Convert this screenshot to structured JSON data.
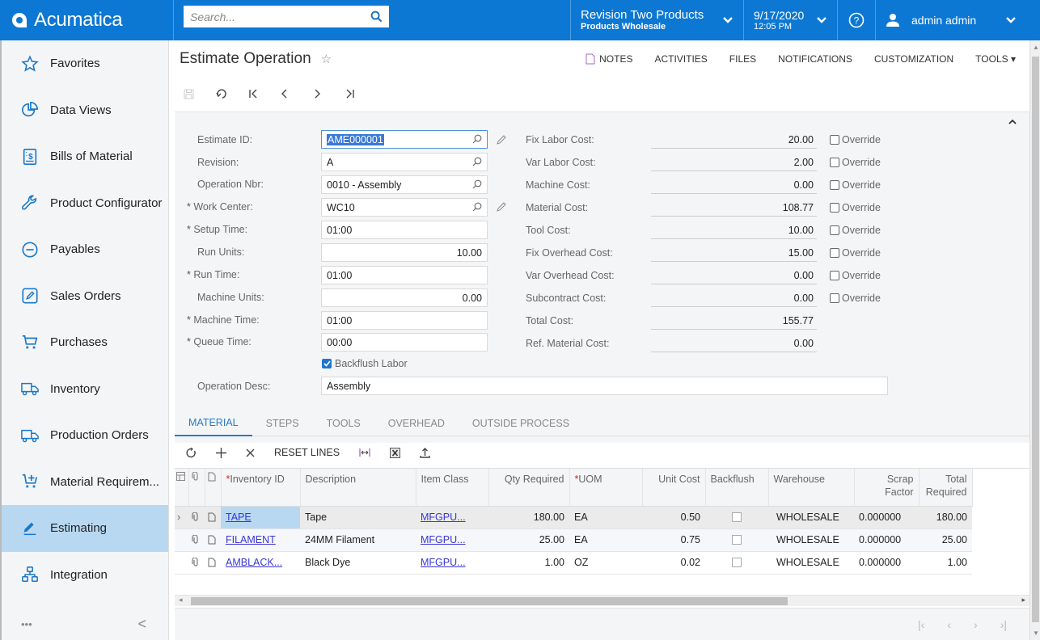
{
  "app": {
    "brand": "Acumatica",
    "search_placeholder": "Search...",
    "company": {
      "name": "Revision Two Products",
      "branch": "Products Wholesale"
    },
    "date": "9/17/2020",
    "time": "12:05 PM",
    "user": "admin admin",
    "accent_color": "#0c78d4"
  },
  "sidebar": {
    "items": [
      {
        "label": "Favorites",
        "icon": "star-icon"
      },
      {
        "label": "Data Views",
        "icon": "pie-chart-icon"
      },
      {
        "label": "Bills of Material",
        "icon": "bill-icon"
      },
      {
        "label": "Product Configurator",
        "icon": "wrench-icon"
      },
      {
        "label": "Payables",
        "icon": "minus-circle-icon"
      },
      {
        "label": "Sales Orders",
        "icon": "edit-square-icon"
      },
      {
        "label": "Purchases",
        "icon": "cart-icon"
      },
      {
        "label": "Inventory",
        "icon": "truck-icon"
      },
      {
        "label": "Production Orders",
        "icon": "truck-icon"
      },
      {
        "label": "Material Requirem...",
        "icon": "cart-plus-icon"
      },
      {
        "label": "Estimating",
        "icon": "pencil-icon",
        "active": true
      },
      {
        "label": "Integration",
        "icon": "hierarchy-icon"
      }
    ],
    "more": "•••",
    "collapse": "<"
  },
  "page": {
    "title": "Estimate Operation",
    "actions": [
      "NOTES",
      "ACTIVITIES",
      "FILES",
      "NOTIFICATIONS",
      "CUSTOMIZATION",
      "TOOLS"
    ]
  },
  "form": {
    "left": {
      "estimate_id": {
        "label": "Estimate ID:",
        "value": "AME000001"
      },
      "revision": {
        "label": "Revision:",
        "value": "A"
      },
      "operation_nbr": {
        "label": "Operation Nbr:",
        "value": "0010 - Assembly"
      },
      "work_center": {
        "label": "Work Center:",
        "value": "WC10"
      },
      "setup_time": {
        "label": "Setup Time:",
        "value": "01:00"
      },
      "run_units": {
        "label": "Run Units:",
        "value": "10.00"
      },
      "run_time": {
        "label": "Run Time:",
        "value": "01:00"
      },
      "machine_units": {
        "label": "Machine Units:",
        "value": "0.00"
      },
      "machine_time": {
        "label": "Machine Time:",
        "value": "01:00"
      },
      "queue_time": {
        "label": "Queue Time:",
        "value": "00:00"
      },
      "backflush_labor": {
        "label": "Backflush Labor",
        "checked": true
      },
      "operation_desc": {
        "label": "Operation Desc:",
        "value": "Assembly"
      }
    },
    "costs": [
      {
        "label": "Fix Labor Cost:",
        "value": "20.00",
        "override": "Override"
      },
      {
        "label": "Var Labor Cost:",
        "value": "2.00",
        "override": "Override"
      },
      {
        "label": "Machine Cost:",
        "value": "0.00",
        "override": "Override"
      },
      {
        "label": "Material Cost:",
        "value": "108.77",
        "override": "Override"
      },
      {
        "label": "Tool Cost:",
        "value": "10.00",
        "override": "Override"
      },
      {
        "label": "Fix Overhead Cost:",
        "value": "15.00",
        "override": "Override"
      },
      {
        "label": "Var Overhead Cost:",
        "value": "0.00",
        "override": "Override"
      },
      {
        "label": "Subcontract Cost:",
        "value": "0.00",
        "override": "Override"
      },
      {
        "label": "Total Cost:",
        "value": "155.77"
      },
      {
        "label": "Ref. Material Cost:",
        "value": "0.00"
      }
    ]
  },
  "tabs": [
    "MATERIAL",
    "STEPS",
    "TOOLS",
    "OVERHEAD",
    "OUTSIDE PROCESS"
  ],
  "grid_toolbar": {
    "reset_lines": "RESET LINES"
  },
  "grid": {
    "headers": {
      "inventory_id": "Inventory ID",
      "description": "Description",
      "item_class": "Item Class",
      "qty_required": "Qty Required",
      "uom": "UOM",
      "unit_cost": "Unit Cost",
      "backflush": "Backflush",
      "warehouse": "Warehouse",
      "scrap_factor": "Scrap Factor",
      "total_required": "Total Required"
    },
    "rows": [
      {
        "inventory_id": "TAPE",
        "description": "Tape",
        "item_class": "MFGPU...",
        "qty_required": "180.00",
        "uom": "EA",
        "unit_cost": "0.50",
        "backflush": false,
        "warehouse": "WHOLESALE",
        "scrap_factor": "0.000000",
        "total_required": "180.00"
      },
      {
        "inventory_id": "FILAMENT",
        "description": "24MM Filament",
        "item_class": "MFGPU...",
        "qty_required": "25.00",
        "uom": "EA",
        "unit_cost": "0.75",
        "backflush": false,
        "warehouse": "WHOLESALE",
        "scrap_factor": "0.000000",
        "total_required": "25.00"
      },
      {
        "inventory_id": "AMBLACK...",
        "description": "Black Dye",
        "item_class": "MFGPU...",
        "qty_required": "1.00",
        "uom": "OZ",
        "unit_cost": "0.02",
        "backflush": false,
        "warehouse": "WHOLESALE",
        "scrap_factor": "0.000000",
        "total_required": "1.00"
      }
    ]
  }
}
